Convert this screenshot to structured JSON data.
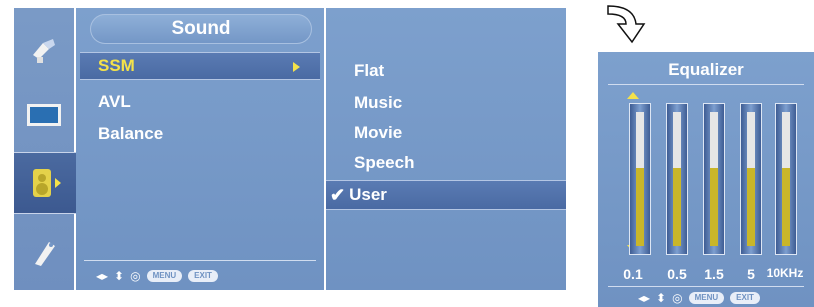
{
  "menu": {
    "title": "Sound",
    "items": [
      {
        "label": "SSM",
        "selected": true
      },
      {
        "label": "AVL",
        "selected": false
      },
      {
        "label": "Balance",
        "selected": false
      }
    ]
  },
  "submenu": {
    "items": [
      {
        "label": "Flat",
        "checked": false
      },
      {
        "label": "Music",
        "checked": false
      },
      {
        "label": "Movie",
        "checked": false
      },
      {
        "label": "Speech",
        "checked": false
      },
      {
        "label": "User",
        "checked": true
      }
    ]
  },
  "nav": {
    "lr_icon": "left-right-arrows-icon",
    "ud_icon": "up-down-arrows-icon",
    "ok_icon": "ok-circle-icon",
    "menu_label": "MENU",
    "exit_label": "EXIT"
  },
  "equalizer": {
    "title": "Equalizer",
    "bands": [
      {
        "freq": "0.1",
        "level": 0.58
      },
      {
        "freq": "0.5",
        "level": 0.58
      },
      {
        "freq": "1.5",
        "level": 0.58
      },
      {
        "freq": "5",
        "level": 0.58
      },
      {
        "freq": "10KHz",
        "level": 0.58
      }
    ]
  },
  "colors": {
    "panel": "#7396c6",
    "highlight_text": "#f4e24a",
    "level_fill": "#c9b62a"
  }
}
